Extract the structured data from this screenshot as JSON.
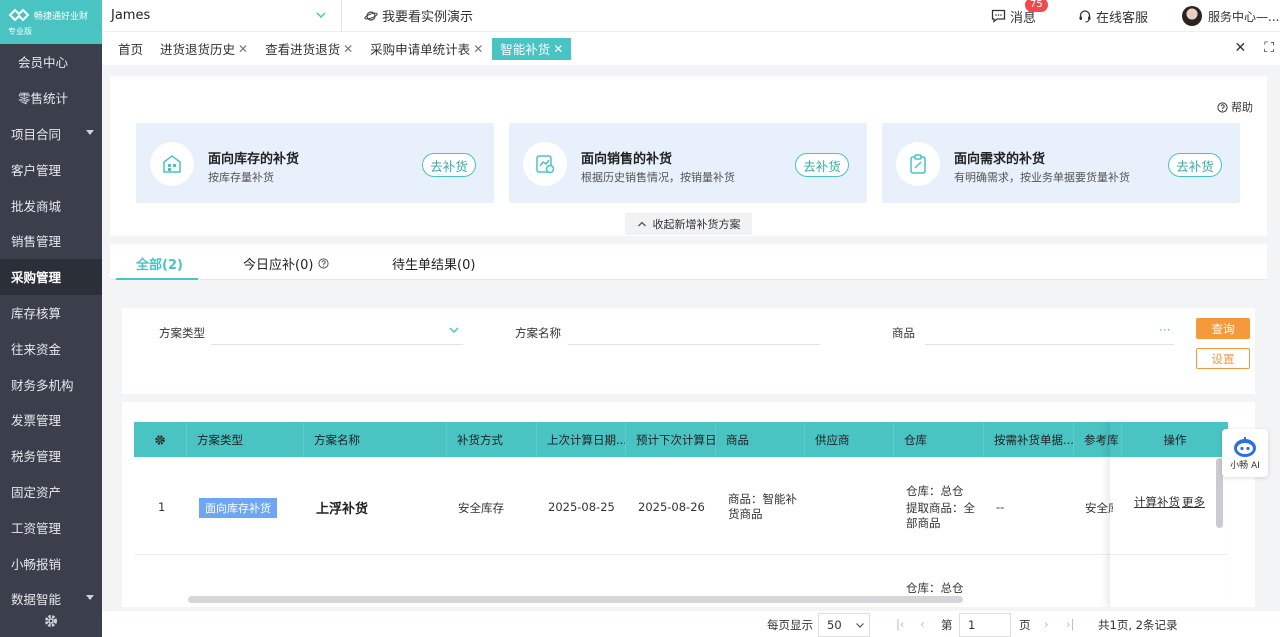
{
  "brand": {
    "name": "畅捷通好业财",
    "edition": "专业版"
  },
  "sidebar": {
    "items": [
      {
        "label": "会员中心",
        "indent": true
      },
      {
        "label": "零售统计",
        "indent": true
      },
      {
        "label": "项目合同",
        "caret": true
      },
      {
        "label": "客户管理"
      },
      {
        "label": "批发商城"
      },
      {
        "label": "销售管理"
      },
      {
        "label": "采购管理",
        "active": true
      },
      {
        "label": "库存核算"
      },
      {
        "label": "往来资金"
      },
      {
        "label": "财务多机构"
      },
      {
        "label": "发票管理"
      },
      {
        "label": "税务管理"
      },
      {
        "label": "固定资产"
      },
      {
        "label": "工资管理"
      },
      {
        "label": "小畅报销"
      },
      {
        "label": "数据智能",
        "caret": true
      }
    ]
  },
  "topbar": {
    "user": "James",
    "demo": "我要看实例演示",
    "messages": "消息",
    "message_count": "75",
    "service": "在线客服",
    "center": "服务中心—..."
  },
  "tabs": [
    {
      "label": "首页",
      "closable": false
    },
    {
      "label": "进货退货历史",
      "closable": true
    },
    {
      "label": "查看进货退货",
      "closable": true
    },
    {
      "label": "采购申请单统计表",
      "closable": true
    },
    {
      "label": "智能补货",
      "closable": true,
      "active": true
    }
  ],
  "panel": {
    "help": "帮助",
    "cards": [
      {
        "title": "面向库存的补货",
        "desc": "按库存量补货",
        "button": "去补货",
        "icon": "warehouse-icon"
      },
      {
        "title": "面向销售的补货",
        "desc": "根据历史销售情况，按销量补货",
        "button": "去补货",
        "icon": "sales-chart-icon"
      },
      {
        "title": "面向需求的补货",
        "desc": "有明确需求，按业务单据要货量补货",
        "button": "去补货",
        "icon": "clipboard-icon"
      }
    ],
    "collapse": "收起新增补货方案"
  },
  "status_tabs": {
    "all": "全部(2)",
    "today": "今日应补(0)",
    "pending": "待生单结果(0)"
  },
  "filter": {
    "type_label": "方案类型",
    "name_label": "方案名称",
    "goods_label": "商品",
    "goods_more": "···",
    "query": "查询",
    "settings": "设置"
  },
  "table": {
    "headers": [
      "方案类型",
      "方案名称",
      "补货方式",
      "上次计算日期...",
      "预计下次计算日期",
      "商品",
      "供应商",
      "仓库",
      "按需补货单据...",
      "参考库",
      "操作"
    ],
    "rows": [
      {
        "index": "1",
        "type": "面向库存补货",
        "name": "上浮补货",
        "method": "安全库存",
        "last_date": "2025-08-25",
        "next_date": "2025-08-26",
        "goods": "商品：智能补货商品",
        "warehouse_line1": "仓库：总仓",
        "warehouse_line2": "提取商品：全部商品",
        "demand": "--",
        "reference": "安全库",
        "op_calc": "计算补货",
        "op_more": "更多"
      },
      {
        "warehouse_line1": "仓库：总仓"
      }
    ]
  },
  "ai": {
    "label": "小畅 AI"
  },
  "pager": {
    "per_page_label": "每页显示",
    "per_page": "50",
    "page_prefix": "第",
    "page": "1",
    "page_suffix": "页",
    "summary": "共1页, 2条记录"
  }
}
